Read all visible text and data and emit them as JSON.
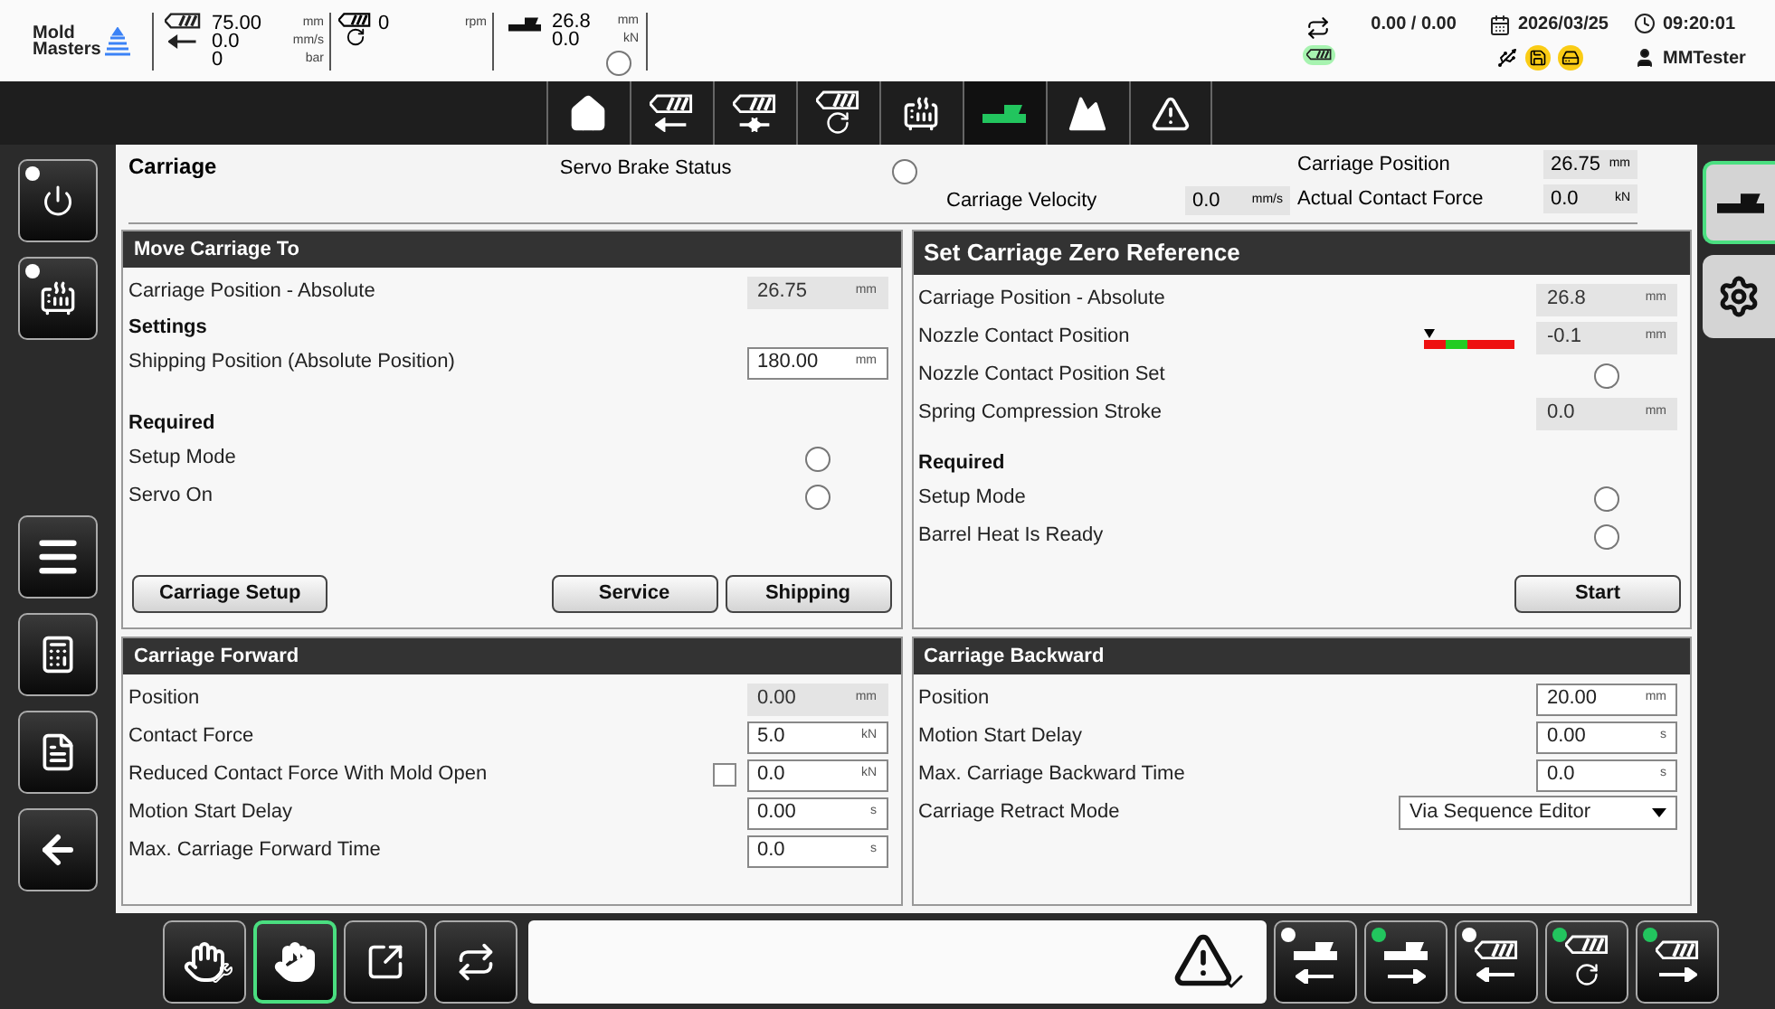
{
  "header": {
    "logo": [
      "Mold",
      "Masters"
    ],
    "injection": {
      "rows": [
        {
          "value": "75.00",
          "unit": "mm"
        },
        {
          "value": "0.0",
          "unit": "mm/s"
        },
        {
          "value": "0",
          "unit": "bar"
        }
      ]
    },
    "screw": {
      "rows": [
        {
          "value": "0",
          "unit": "rpm"
        }
      ]
    },
    "carriage": {
      "rows": [
        {
          "value": "26.8",
          "unit": "mm"
        },
        {
          "value": "0.0",
          "unit": "kN"
        }
      ],
      "contact_on": false
    },
    "cycle": "0.00 / 0.00",
    "date": "2026/03/25",
    "time": "09:20:01",
    "user": "MMTester"
  },
  "nav_tabs": [
    {
      "kind": "home",
      "selected": false
    },
    {
      "kind": "inject",
      "selected": false
    },
    {
      "kind": "hold",
      "selected": false
    },
    {
      "kind": "screw",
      "selected": false
    },
    {
      "kind": "heat",
      "selected": false
    },
    {
      "kind": "carriage",
      "selected": true
    },
    {
      "kind": "profile",
      "selected": false
    },
    {
      "kind": "alarm",
      "selected": false
    }
  ],
  "left_sidebar": [
    {
      "kind": "power",
      "lamp_on": false
    },
    {
      "kind": "heat",
      "lamp_on": false
    },
    {
      "kind": "menu"
    },
    {
      "kind": "calculator"
    },
    {
      "kind": "document"
    },
    {
      "kind": "back"
    }
  ],
  "right_sidebar": [
    {
      "kind": "carriage",
      "selected": true
    },
    {
      "kind": "gears",
      "selected": false
    }
  ],
  "carriage": {
    "title": "Carriage",
    "brake_label": "Servo Brake Status",
    "brake_on": false,
    "velocity": {
      "label": "Carriage Velocity",
      "value": "0.0",
      "unit": "mm/s"
    },
    "position": {
      "label": "Carriage Position",
      "value": "26.75",
      "unit": "mm"
    },
    "force": {
      "label": "Actual Contact Force",
      "value": "0.0",
      "unit": "kN"
    }
  },
  "panels": [
    {
      "title": "Move Carriage To",
      "sections": [
        {
          "rows": [
            {
              "kind": "readonly",
              "label": "Carriage Position - Absolute",
              "value": "26.75",
              "unit": "mm"
            }
          ]
        },
        {
          "heading": "Settings",
          "rows": [
            {
              "kind": "input",
              "label": "Shipping Position (Absolute Position)",
              "value": "180.00",
              "unit": "mm"
            }
          ]
        },
        {
          "heading": "Required",
          "rows": [
            {
              "kind": "radio",
              "label": "Setup Mode",
              "on": false
            },
            {
              "kind": "radio",
              "label": "Servo On",
              "on": false
            }
          ]
        }
      ],
      "buttons_left": [
        "Carriage Setup"
      ],
      "buttons_right": [
        "Service",
        "Shipping"
      ]
    },
    {
      "title": "Set Carriage Zero Reference",
      "sections": [
        {
          "rows": [
            {
              "kind": "readonly",
              "label": "Carriage Position - Absolute",
              "value": "26.8",
              "unit": "mm"
            },
            {
              "kind": "readonly",
              "label": "Nozzle Contact Position",
              "value": "-0.1",
              "unit": "mm",
              "gauge": true
            },
            {
              "kind": "radio",
              "label": "Nozzle Contact Position Set",
              "on": false
            },
            {
              "kind": "readonly",
              "label": "Spring Compression Stroke",
              "value": "0.0",
              "unit": "mm"
            }
          ]
        },
        {
          "heading": "Required",
          "rows": [
            {
              "kind": "radio",
              "label": "Setup Mode",
              "on": false
            },
            {
              "kind": "radio",
              "label": "Barrel Heat Is Ready",
              "on": false
            }
          ]
        }
      ],
      "buttons_right": [
        "Start"
      ]
    },
    {
      "title": "Carriage Forward",
      "sections": [
        {
          "rows": [
            {
              "kind": "readonly",
              "label": "Position",
              "value": "0.00",
              "unit": "mm"
            },
            {
              "kind": "input",
              "label": "Contact Force",
              "value": "5.0",
              "unit": "kN"
            },
            {
              "kind": "input",
              "label": "Reduced Contact Force With Mold Open",
              "value": "0.0",
              "unit": "kN",
              "checked": false
            },
            {
              "kind": "input",
              "label": "Motion Start Delay",
              "value": "0.00",
              "unit": "s"
            },
            {
              "kind": "input",
              "label": "Max. Carriage Forward Time",
              "value": "0.0",
              "unit": "s"
            }
          ]
        }
      ]
    },
    {
      "title": "Carriage Backward",
      "sections": [
        {
          "rows": [
            {
              "kind": "input",
              "label": "Position",
              "value": "20.00",
              "unit": "mm"
            },
            {
              "kind": "input",
              "label": "Motion Start Delay",
              "value": "0.00",
              "unit": "s"
            },
            {
              "kind": "input",
              "label": "Max. Carriage Backward Time",
              "value": "0.0",
              "unit": "s"
            },
            {
              "kind": "dropdown",
              "label": "Carriage Retract Mode",
              "value": "Via Sequence Editor"
            }
          ]
        }
      ]
    }
  ],
  "modes": [
    {
      "kind": "setup",
      "selected": false
    },
    {
      "kind": "manual",
      "selected": true
    },
    {
      "kind": "semi",
      "selected": false
    },
    {
      "kind": "auto",
      "selected": false
    }
  ],
  "actions": [
    {
      "kind": "carriage-back",
      "lamp_on": false
    },
    {
      "kind": "carriage-forward",
      "lamp_on": true
    },
    {
      "kind": "inject-back",
      "lamp_on": false
    },
    {
      "kind": "screw",
      "lamp_on": true
    },
    {
      "kind": "inject-forward",
      "lamp_on": true
    }
  ]
}
